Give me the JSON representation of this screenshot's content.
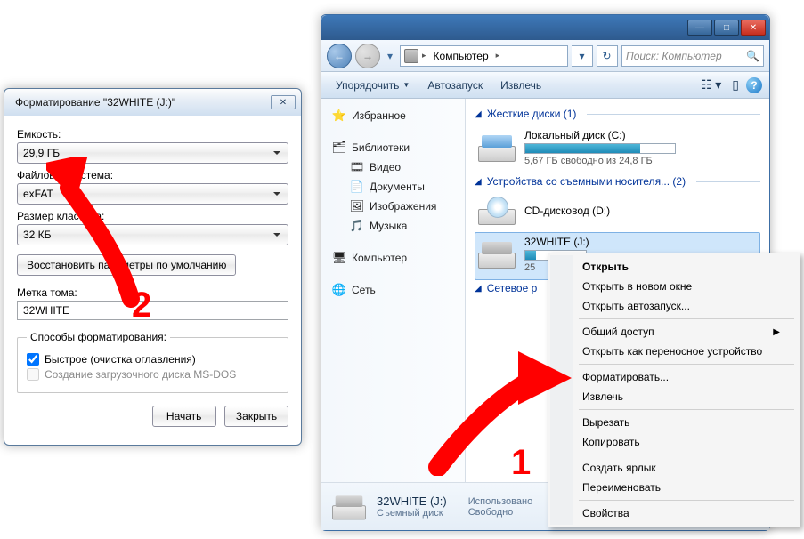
{
  "format_dialog": {
    "title": "Форматирование \"32WHITE (J:)\"",
    "close_glyph": "✕",
    "labels": {
      "capacity": "Емкость:",
      "filesystem": "Файловая система:",
      "cluster": "Размер кластера:",
      "volume_label": "Метка тома:",
      "format_options": "Способы форматирования:"
    },
    "values": {
      "capacity": "29,9 ГБ",
      "filesystem": "exFAT",
      "cluster": "32 КБ",
      "volume_label": "32WHITE"
    },
    "buttons": {
      "restore_defaults": "Восстановить параметры по умолчанию",
      "start": "Начать",
      "close": "Закрыть"
    },
    "checkboxes": {
      "quick": "Быстрое (очистка оглавления)",
      "msdos": "Создание загрузочного диска MS-DOS"
    },
    "quick_checked": true
  },
  "explorer": {
    "title_buttons": {
      "min": "—",
      "max": "□",
      "close": "✕"
    },
    "nav": {
      "back": "←",
      "forward": "→",
      "drop": "▾"
    },
    "address": {
      "root": "Компьютер",
      "tri": "▸",
      "refresh": "↻"
    },
    "search_placeholder": "Поиск: Компьютер",
    "menu": {
      "organize": "Упорядочить",
      "autoplay": "Автозапуск",
      "eject": "Извлечь",
      "help": "?"
    },
    "navpane": {
      "favorites": "Избранное",
      "libraries": "Библиотеки",
      "videos": "Видео",
      "documents": "Документы",
      "pictures": "Изображения",
      "music": "Музыка",
      "computer": "Компьютер",
      "network": "Сеть"
    },
    "groups": {
      "hdd": "Жесткие диски (1)",
      "removable": "Устройства со съемными носителя... (2)",
      "netloc": "Сетевое р"
    },
    "drives": {
      "c": {
        "title": "Локальный диск (C:)",
        "sub": "5,67 ГБ свободно из 24,8 ГБ",
        "fill_pct": 77
      },
      "dvd": {
        "title": "CD-дисковод (D:)"
      },
      "j": {
        "title": "32WHITE (J:)",
        "sub": "25"
      }
    },
    "details": {
      "line1": "32WHITE (J:)",
      "line2": "Съемный диск",
      "col2a": "Использовано",
      "col2b": "Свободно"
    }
  },
  "context_menu": {
    "open": "Открыть",
    "open_new": "Открыть в новом окне",
    "open_autoplay": "Открыть автозапуск...",
    "sharing": "Общий доступ",
    "portable": "Открыть как переносное устройство",
    "format": "Форматировать...",
    "eject": "Извлечь",
    "cut": "Вырезать",
    "copy": "Копировать",
    "shortcut": "Создать ярлык",
    "rename": "Переименовать",
    "properties": "Свойства"
  },
  "annotations": {
    "one": "1",
    "two": "2"
  }
}
